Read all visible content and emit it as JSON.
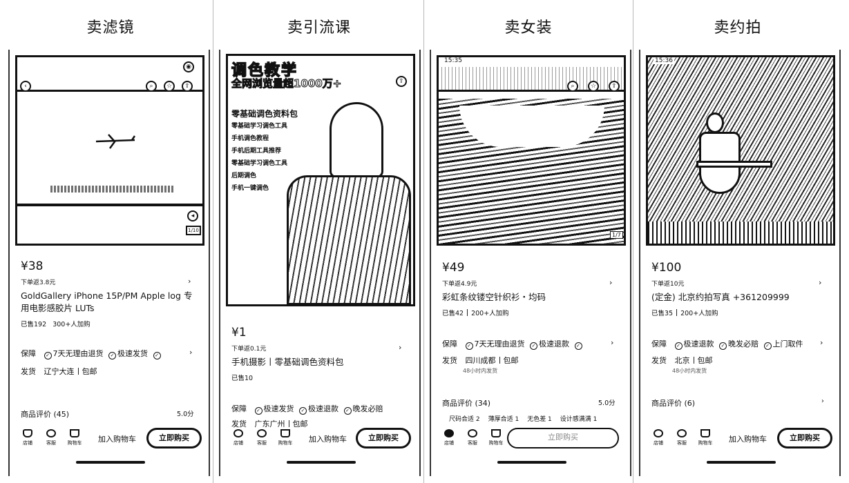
{
  "columns": [
    {
      "title": "卖滤镜",
      "overlay_text": "",
      "price": "¥38",
      "sub": "下单返3.8元",
      "name": "GoldGallery iPhone 15P/PM Apple log 专用电影感胶片 LUTs",
      "sold": "已售192",
      "sold_extra": "300+人加购",
      "guarantee_label": "保障",
      "guarantees": [
        "7天无理由退货",
        "极速发货"
      ],
      "ship_label": "发货",
      "ship_from": "辽宁大连",
      "ship_fee": "包邮",
      "ship_note": "",
      "reviews": "商品评价 (45)",
      "score": "5.0分",
      "nav": [
        "店铺",
        "客服",
        "购物车"
      ],
      "cart": "加入购物车",
      "buy": "立即购买",
      "clock": ""
    },
    {
      "title": "卖引流课",
      "overlay_text": "调色教学",
      "overlay_text_2": "全网浏览量超1000万+",
      "overlay_lines": [
        "零基础调色资料包",
        "零基础学习调色工具",
        "手机调色教程",
        "手机后期工具推荐",
        "零基础学习调色工具",
        "后期调色",
        "手机一键调色"
      ],
      "price": "¥1",
      "sub": "下单返0.1元",
      "name": "手机摄影丨零基础调色资料包",
      "sold": "已售10",
      "sold_extra": "",
      "guarantee_label": "保障",
      "guarantees": [
        "极速发货",
        "极速退款",
        "晚发必赔"
      ],
      "ship_label": "发货",
      "ship_from": "广东广州",
      "ship_fee": "包邮",
      "ship_note": "",
      "reviews": "",
      "score": "",
      "nav": [
        "店铺",
        "客服",
        "购物车"
      ],
      "cart": "加入购物车",
      "buy": "立即购买",
      "clock": ""
    },
    {
      "title": "卖女装",
      "overlay_text": "",
      "price": "¥49",
      "sub": "下单返4.9元",
      "name": "彩虹条纹镂空针织衫・均码",
      "sold": "已售42",
      "sold_extra": "200+人加购",
      "guarantee_label": "保障",
      "guarantees": [
        "7天无理由退货",
        "极速退款"
      ],
      "ship_label": "发货",
      "ship_from": "四川成都",
      "ship_fee": "包邮",
      "ship_note": "48小时内发货",
      "reviews": "商品评价 (34)",
      "score": "5.0分",
      "tags": [
        "尺码合适 2",
        "薄厚合适 1",
        "无色差 1",
        "设计感满满 1"
      ],
      "nav": [
        "店铺",
        "客服",
        "购物车"
      ],
      "cart": "",
      "buy": "立即购买",
      "clock": "15:35"
    },
    {
      "title": "卖约拍",
      "overlay_text": "",
      "price": "¥100",
      "sub": "下单返10元",
      "name": "(定金) 北京约拍写真 +361209999",
      "sold": "已售35",
      "sold_extra": "200+人加购",
      "guarantee_label": "保障",
      "guarantees": [
        "极速退款",
        "晚发必赔",
        "上门取件"
      ],
      "ship_label": "发货",
      "ship_from": "北京",
      "ship_fee": "包邮",
      "ship_note": "48小时内发货",
      "reviews": "商品评价 (6)",
      "score": "",
      "nav": [
        "店铺",
        "客服",
        "购物车"
      ],
      "cart": "加入购物车",
      "buy": "立即购买",
      "clock": "15:36"
    }
  ]
}
